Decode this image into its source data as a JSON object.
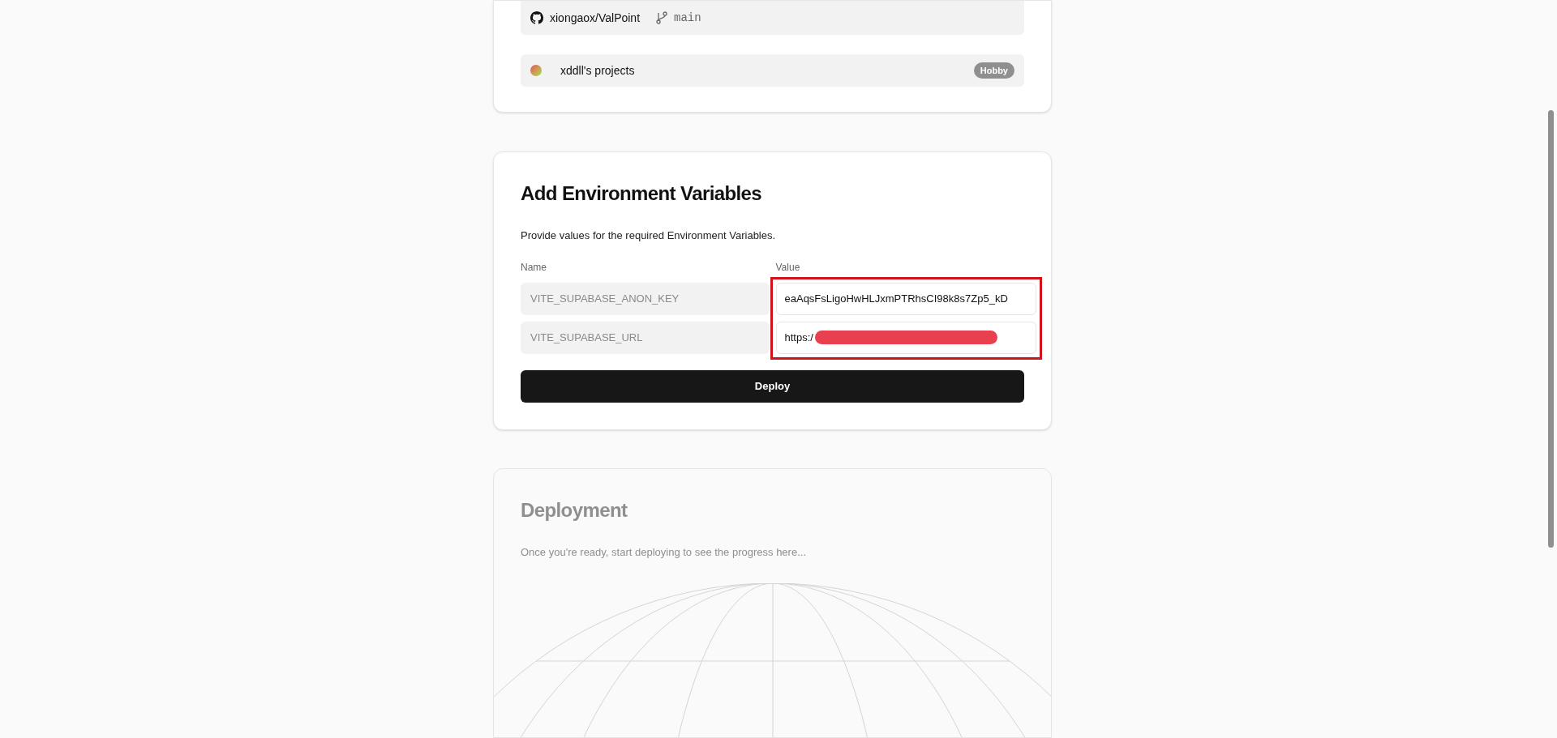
{
  "repository": {
    "repo": "xiongaox/ValPoint",
    "branch": "main"
  },
  "team": {
    "name": "xddll's projects",
    "plan": "Hobby"
  },
  "environment": {
    "title": "Add Environment Variables",
    "description": "Provide values for the required Environment Variables.",
    "name_label": "Name",
    "value_label": "Value",
    "highlighted": true,
    "variables": [
      {
        "name": "VITE_SUPABASE_ANON_KEY",
        "value": "eaAqsFsLigoHwHLJxmPTRhsCI98k8s7Zp5_kD",
        "redacted": false
      },
      {
        "name": "VITE_SUPABASE_URL",
        "value": "https:/",
        "redacted": true
      }
    ],
    "button": "Deploy"
  },
  "deployment": {
    "title": "Deployment",
    "description": "Once you're ready, start deploying to see the progress here..."
  }
}
